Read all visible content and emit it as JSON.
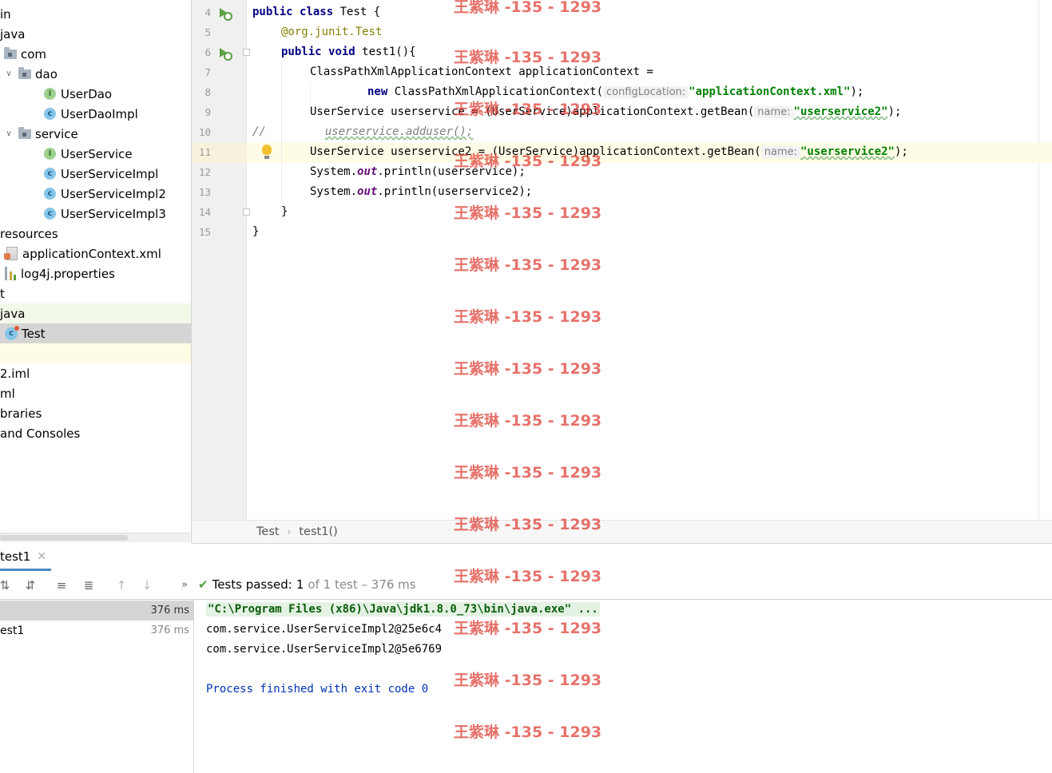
{
  "project_tree": {
    "items": [
      {
        "label": "in",
        "indent": 0,
        "icon": "none"
      },
      {
        "label": "java",
        "indent": 0,
        "icon": "none"
      },
      {
        "label": "com",
        "indent": 1,
        "icon": "package-folder"
      },
      {
        "label": "dao",
        "indent": 1,
        "icon": "package-folder",
        "expanded": true
      },
      {
        "label": "UserDao",
        "indent": 2,
        "icon": "interface"
      },
      {
        "label": "UserDaoImpl",
        "indent": 2,
        "icon": "class"
      },
      {
        "label": "service",
        "indent": 1,
        "icon": "package-folder",
        "expanded": true
      },
      {
        "label": "UserService",
        "indent": 2,
        "icon": "interface"
      },
      {
        "label": "UserServiceImpl",
        "indent": 2,
        "icon": "class"
      },
      {
        "label": "UserServiceImpl2",
        "indent": 2,
        "icon": "class"
      },
      {
        "label": "UserServiceImpl3",
        "indent": 2,
        "icon": "class"
      },
      {
        "label": "resources",
        "indent": 0,
        "icon": "none"
      },
      {
        "label": "applicationContext.xml",
        "indent": 1,
        "icon": "xml"
      },
      {
        "label": "log4j.properties",
        "indent": 1,
        "icon": "properties"
      },
      {
        "label": "t",
        "indent": 0,
        "icon": "none"
      },
      {
        "label": "java",
        "indent": 0,
        "icon": "none"
      },
      {
        "label": "Test",
        "indent": 1,
        "icon": "test-class"
      },
      {
        "label": "",
        "indent": 0,
        "icon": "none"
      },
      {
        "label": "2.iml",
        "indent": 0,
        "icon": "none"
      },
      {
        "label": "ml",
        "indent": 0,
        "icon": "none"
      },
      {
        "label": "braries",
        "indent": 0,
        "icon": "none"
      },
      {
        "label": "and Consoles",
        "indent": 0,
        "icon": "none"
      }
    ]
  },
  "editor": {
    "line_numbers": [
      "4",
      "5",
      "6",
      "7",
      "8",
      "9",
      "10",
      "11",
      "12",
      "13",
      "14",
      "15"
    ],
    "lines": {
      "l4": {
        "kw1": "public",
        "kw2": "class",
        "rest": " Test {"
      },
      "l5": {
        "at": "@org.junit.",
        "ann": "Test"
      },
      "l6": {
        "kw1": "public",
        "kw2": "void",
        "rest": " test1(){"
      },
      "l7": {
        "text": "ClassPathXmlApplicationContext applicationContext ="
      },
      "l8": {
        "kw": "new",
        "text": " ClassPathXmlApplicationContext(",
        "hint": "configLocation:",
        "str": "\"applicationContext.xml\"",
        "end": ");"
      },
      "l9": {
        "text": "UserService userservice = (UserService)applicationContext.getBean(",
        "hint": "name:",
        "str": "\"userservice2\"",
        "end": ");"
      },
      "l10": {
        "slashes": "//",
        "text": "userservice.adduser();"
      },
      "l11": {
        "text": "UserService userservice2 = (UserService)applicationContext.getBean(",
        "hint": "name:",
        "str": "\"userservice2\"",
        "end": ");"
      },
      "l12": {
        "a": "System.",
        "b": "out",
        "c": ".println(userservice);"
      },
      "l13": {
        "a": "System.",
        "b": "out",
        "c": ".println(userservice2);"
      },
      "l14": {
        "text": "}"
      },
      "l15": {
        "text": "}"
      }
    }
  },
  "breadcrumb": {
    "items": [
      "Test",
      "test1()"
    ]
  },
  "run_panel": {
    "tab_label": "test1",
    "status_label": "Tests passed:",
    "status_count": "1",
    "status_detail": "of 1 test – 376 ms",
    "results": [
      {
        "label": "",
        "time": "376 ms"
      },
      {
        "label": "est1",
        "time": "376 ms"
      }
    ],
    "console": [
      "\"C:\\Program Files (x86)\\Java\\jdk1.8.0_73\\bin\\java.exe\" ...",
      "com.service.UserServiceImpl2@25e6c4",
      "com.service.UserServiceImpl2@5e6769",
      "",
      "Process finished with exit code 0"
    ]
  },
  "watermark": "王紫琳 -135 - 1293"
}
